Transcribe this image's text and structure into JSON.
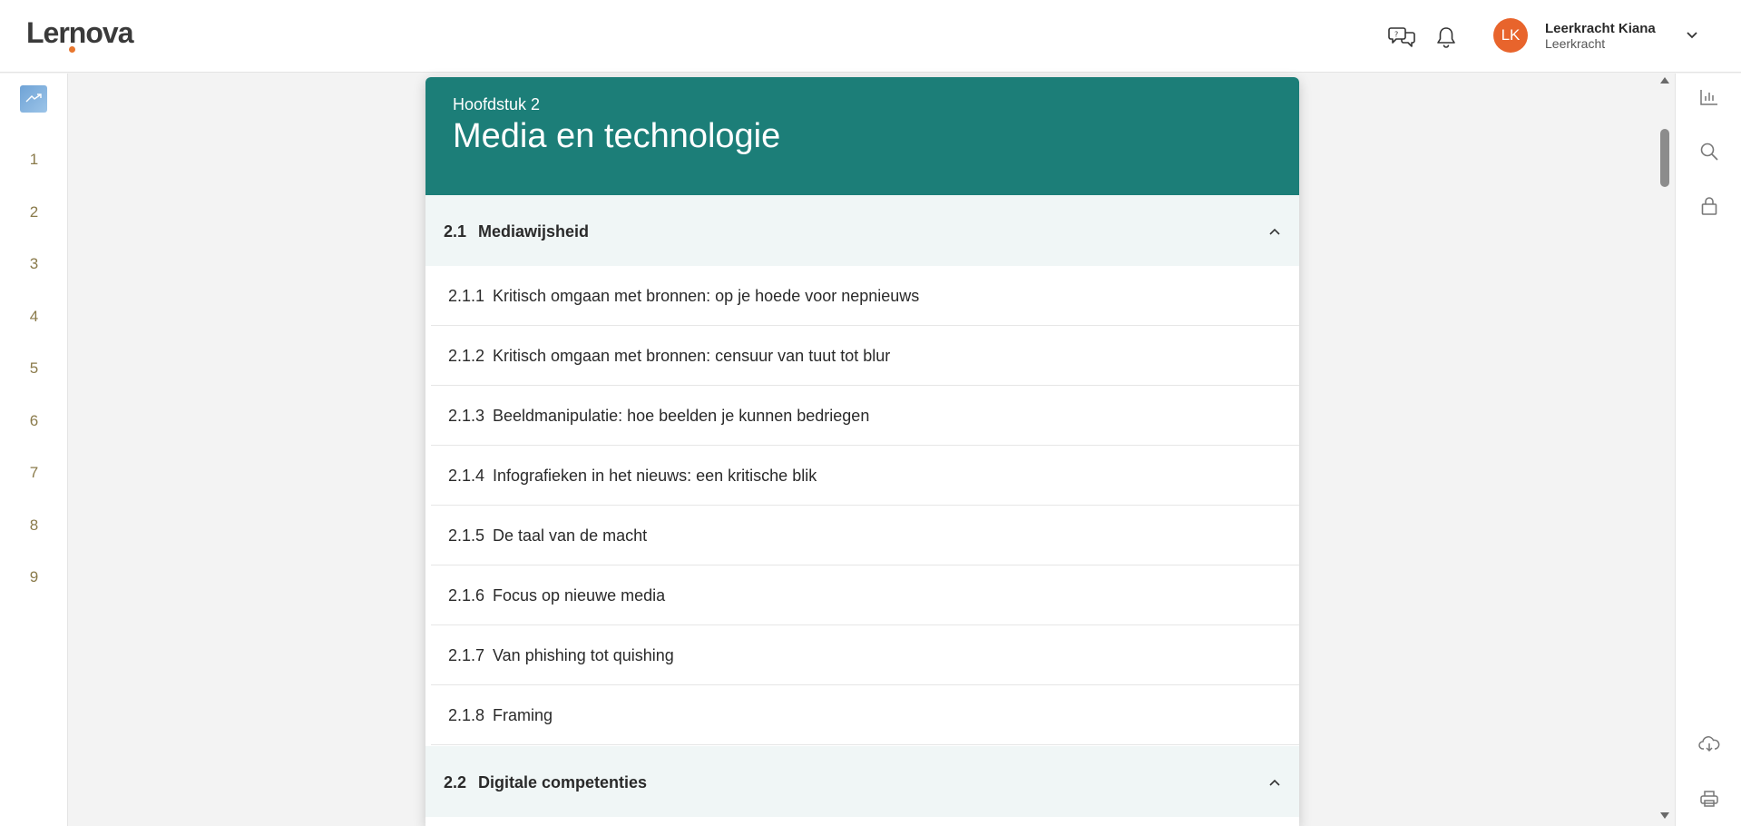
{
  "app": {
    "logo": "Lernova"
  },
  "header": {
    "icons": [
      "chat-bubbles-icon",
      "bell-icon"
    ],
    "user": {
      "initials": "LK",
      "name": "Leerkracht Kiana",
      "role": "Leerkracht"
    },
    "colors": {
      "avatar": "#e8642c",
      "logo_dot": "#e8772e"
    }
  },
  "sidebar": {
    "chapters": [
      "1",
      "2",
      "3",
      "4",
      "5",
      "6",
      "7",
      "8",
      "9"
    ]
  },
  "right_toolbar": {
    "icons": [
      "bar-chart-icon",
      "search-icon",
      "lock-icon",
      "cloud-download-icon",
      "printer-icon"
    ]
  },
  "chapter": {
    "label": "Hoofdstuk 2",
    "title": "Media en technologie",
    "color": "#1c7e78"
  },
  "sections": [
    {
      "number": "2.1",
      "title": "Mediawijsheid",
      "expanded": true,
      "items": [
        {
          "number": "2.1.1",
          "title": "Kritisch omgaan met bronnen: op je hoede voor nepnieuws"
        },
        {
          "number": "2.1.2",
          "title": "Kritisch omgaan met bronnen: censuur van tuut tot blur"
        },
        {
          "number": "2.1.3",
          "title": "Beeldmanipulatie: hoe beelden je kunnen bedriegen"
        },
        {
          "number": "2.1.4",
          "title": "Infografieken in het nieuws: een kritische blik"
        },
        {
          "number": "2.1.5",
          "title": "De taal van de macht"
        },
        {
          "number": "2.1.6",
          "title": "Focus op nieuwe media"
        },
        {
          "number": "2.1.7",
          "title": "Van phishing tot quishing"
        },
        {
          "number": "2.1.8",
          "title": "Framing"
        }
      ]
    },
    {
      "number": "2.2",
      "title": "Digitale competenties",
      "expanded": true,
      "items": []
    }
  ]
}
